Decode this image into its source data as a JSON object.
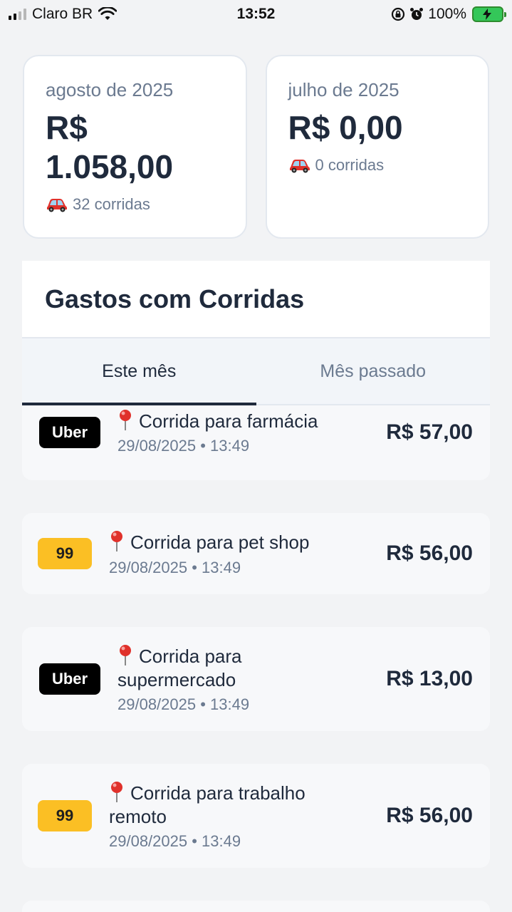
{
  "status_bar": {
    "carrier": "Claro BR",
    "time": "13:52",
    "battery": "100%"
  },
  "summary": [
    {
      "month": "agosto de 2025",
      "amount_line1": "R$",
      "amount_line2": "1.058,00",
      "rides": "32 corridas"
    },
    {
      "month": "julho de 2025",
      "amount_line1": "R$ 0,00",
      "amount_line2": "",
      "rides": "0 corridas"
    }
  ],
  "section": {
    "title": "Gastos com Corridas",
    "tabs": [
      {
        "label": "Este mês",
        "active": true
      },
      {
        "label": "Mês passado",
        "active": false
      }
    ]
  },
  "rides": [
    {
      "provider": "Uber",
      "title_line1": "Corrida para farmácia",
      "title_line2": "",
      "date": "29/08/2025 • 13:49",
      "amount": "R$ 57,00"
    },
    {
      "provider": "99",
      "title_line1": "Corrida para pet shop",
      "title_line2": "",
      "date": "29/08/2025 • 13:49",
      "amount": "R$ 56,00"
    },
    {
      "provider": "Uber",
      "title_line1": "Corrida para",
      "title_line2": "supermercado",
      "date": "29/08/2025 • 13:49",
      "amount": "R$ 13,00"
    },
    {
      "provider": "99",
      "title_line1": "Corrida para trabalho",
      "title_line2": "remoto",
      "date": "29/08/2025 • 13:49",
      "amount": "R$ 56,00"
    }
  ],
  "colors": {
    "uber_badge": "#000000",
    "badge_99": "#fbbf24",
    "text_primary": "#1f2a3c",
    "text_secondary": "#6b7a90"
  }
}
